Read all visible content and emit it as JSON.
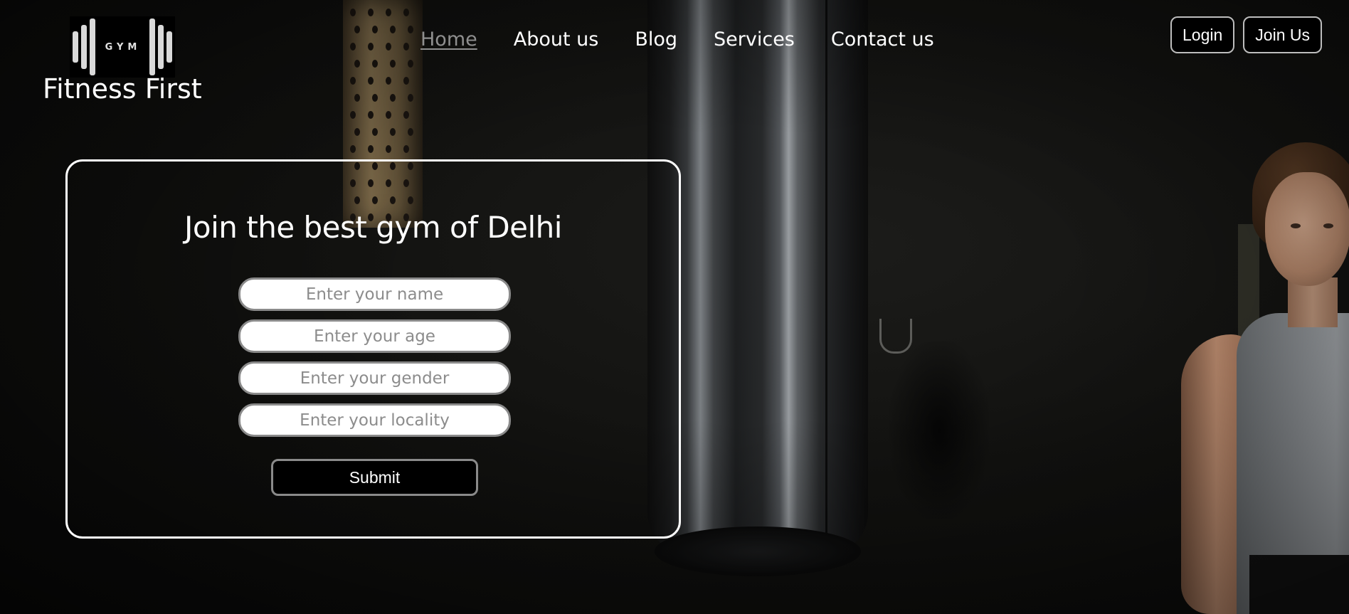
{
  "brand": {
    "logo_text": "GYM",
    "name": "Fitness First"
  },
  "nav": {
    "items": [
      {
        "label": "Home",
        "active": true
      },
      {
        "label": "About us",
        "active": false
      },
      {
        "label": "Blog",
        "active": false
      },
      {
        "label": "Services",
        "active": false
      },
      {
        "label": "Contact us",
        "active": false
      }
    ]
  },
  "auth": {
    "login_label": "Login",
    "join_label": "Join Us"
  },
  "form": {
    "title": "Join the best gym of Delhi",
    "fields": {
      "name_placeholder": "Enter your name",
      "age_placeholder": "Enter your age",
      "gender_placeholder": "Enter your gender",
      "locality_placeholder": "Enter your locality"
    },
    "submit_label": "Submit"
  },
  "colors": {
    "background": "#0b0b0a",
    "text": "#ffffff",
    "active_nav": "#8f8f8f",
    "button_bg": "#000000",
    "button_border": "#bdbdbd"
  },
  "icons": {
    "logo": "dumbbell-logo-icon"
  }
}
